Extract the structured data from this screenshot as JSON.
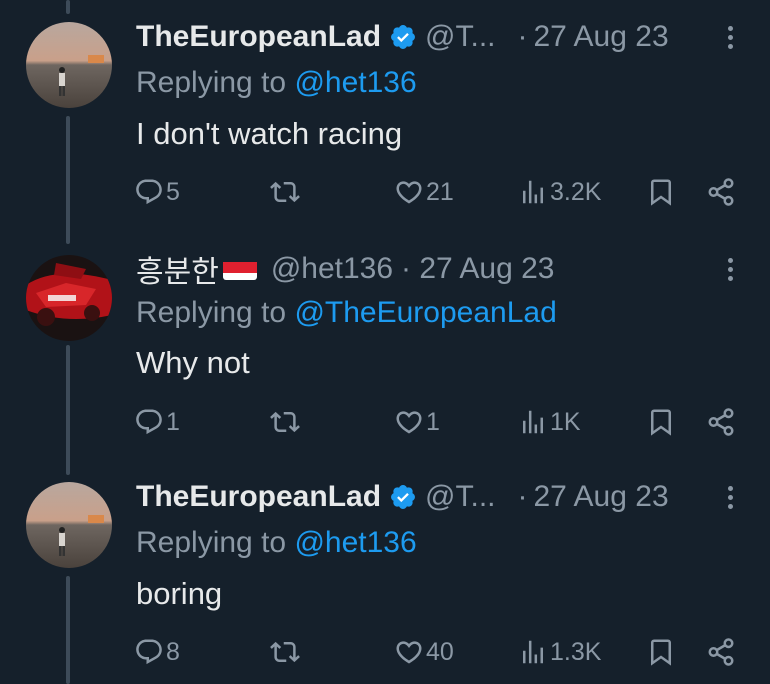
{
  "colors": {
    "background": "#15202b",
    "text": "#e7e9ea",
    "muted": "#8b98a5",
    "accent": "#1d9bf0",
    "thread_line": "#3d4b59"
  },
  "tweets": [
    {
      "name": "TheEuropeanLad",
      "verified": true,
      "handle": "@T...",
      "date": "27 Aug 23",
      "replying_prefix": "Replying to",
      "replying_to": "@het136",
      "text": "I don't watch racing",
      "replies": "5",
      "retweets": "",
      "likes": "21",
      "views": "3.2K",
      "avatar_icon": "avatar-person-desert"
    },
    {
      "name": "흥분한",
      "flag_icon": "flag-indonesia-monaco",
      "verified": false,
      "handle": "@het136",
      "date": "· 27 Aug 23",
      "replying_prefix": "Replying to",
      "replying_to": "@TheEuropeanLad",
      "text": "Why not",
      "replies": "1",
      "retweets": "",
      "likes": "1",
      "views": "1K",
      "avatar_icon": "avatar-racing-car"
    },
    {
      "name": "TheEuropeanLad",
      "verified": true,
      "handle": "@T...",
      "date": "27 Aug 23",
      "replying_prefix": "Replying to",
      "replying_to": "@het136",
      "text": "boring",
      "replies": "8",
      "retweets": "",
      "likes": "40",
      "views": "1.3K",
      "avatar_icon": "avatar-person-desert"
    }
  ]
}
